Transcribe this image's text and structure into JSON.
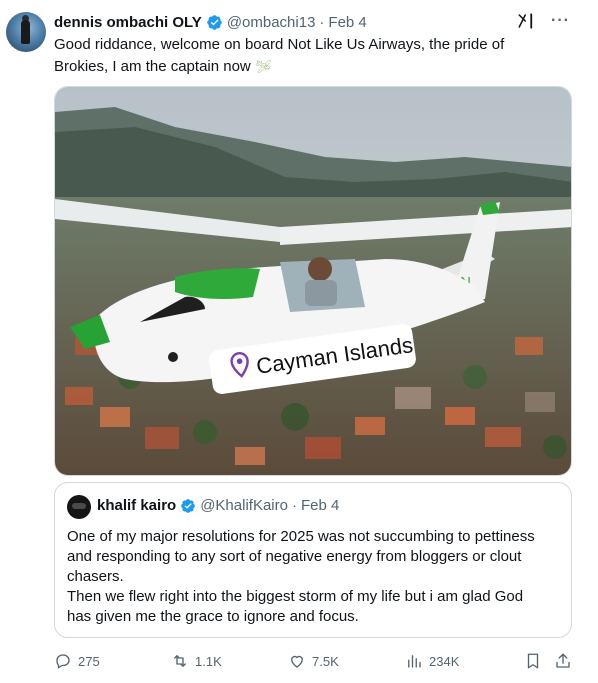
{
  "tweet": {
    "author": {
      "name": "dennis ombachi OLY",
      "handle": "@ombachi13",
      "separator": "·",
      "date": "Feb 4"
    },
    "text_lines": [
      "Good riddance, welcome on board Not Like Us Airways, the pride of",
      "Brokies, I am the captain now"
    ],
    "emoji": "🛩",
    "media": {
      "location_tag": "Cayman Islands",
      "tail_text": "ЮN"
    },
    "quote": {
      "author": {
        "name": "khalif kairo",
        "handle": "@KhalifKairo",
        "separator": "·",
        "date": "Feb 4"
      },
      "text_lines": [
        "One of my major resolutions for 2025 was not succumbing to pettiness",
        "and responding to any sort of negative energy from bloggers or clout",
        "chasers.",
        "Then we flew right into the biggest storm of my life but i am glad God",
        "has given me the grace to ignore and focus."
      ]
    },
    "actions": {
      "replies": "275",
      "reposts": "1.1K",
      "likes": "7.5K",
      "views": "234K"
    }
  },
  "colors": {
    "verified": "#1d9bf0",
    "muted": "#536471",
    "border": "#cfd9de",
    "plane_green": "#2faa3a",
    "location_pin": "#7b3fb0"
  }
}
